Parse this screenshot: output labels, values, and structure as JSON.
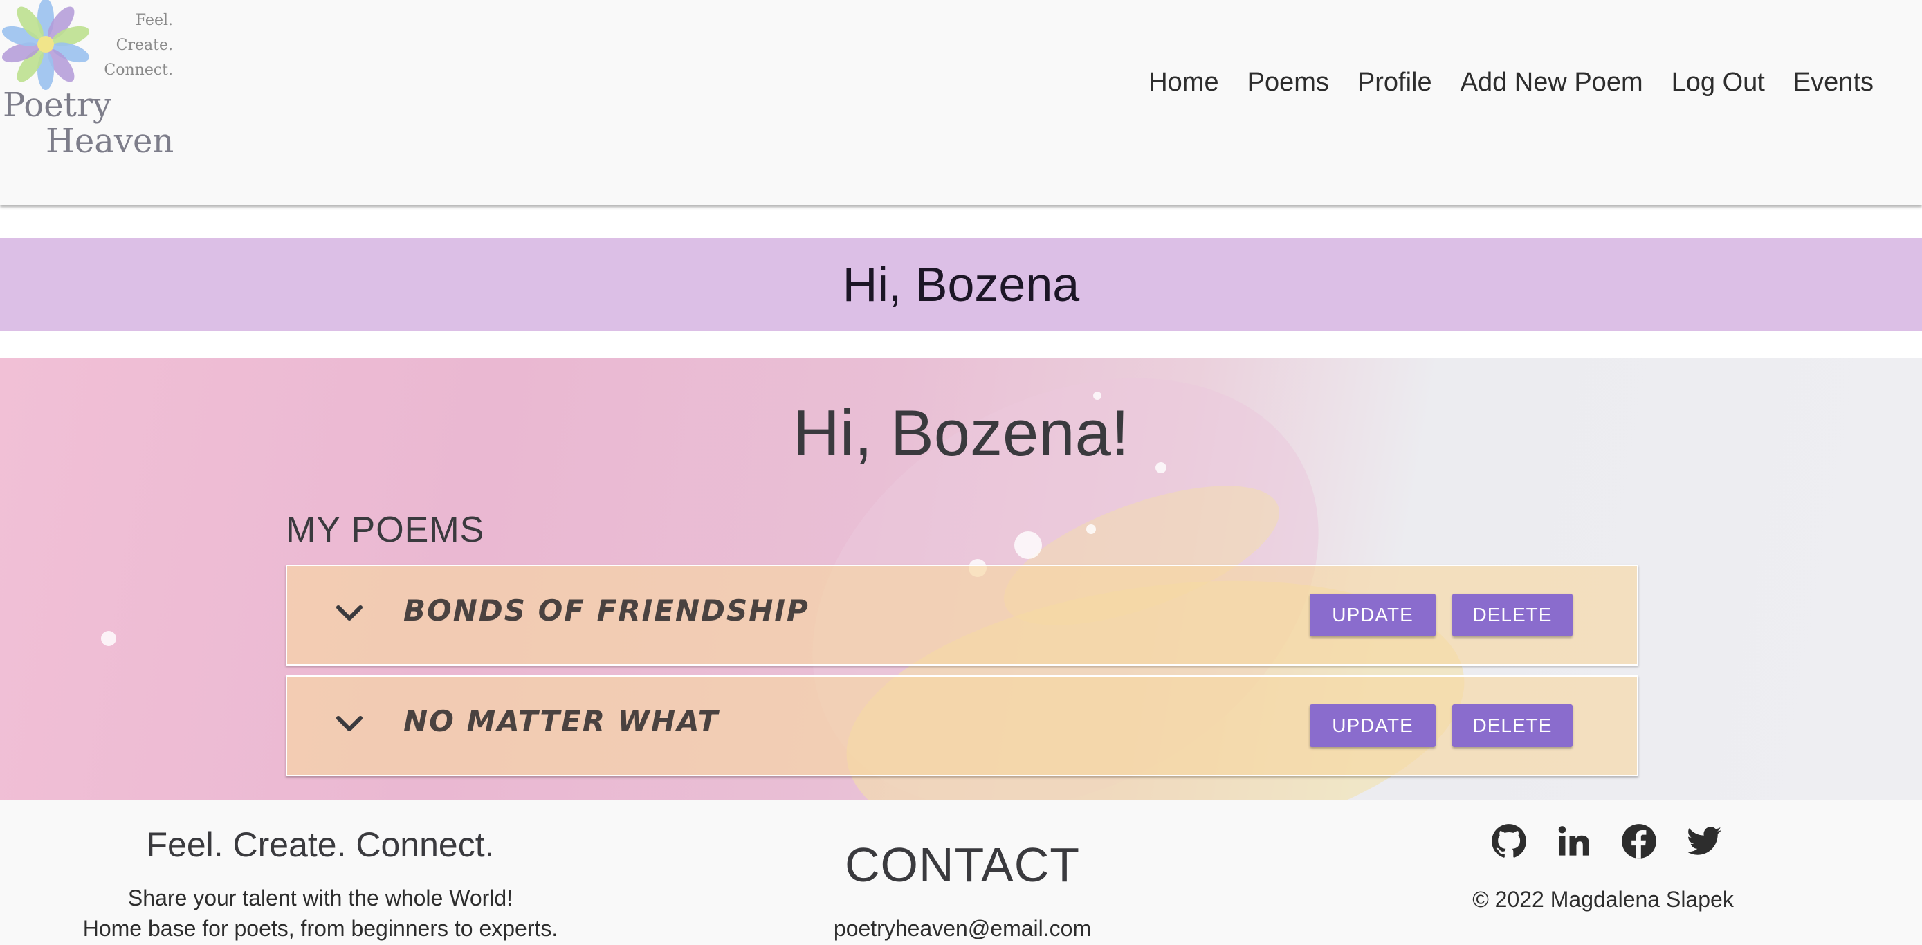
{
  "logo": {
    "tagline": [
      "Feel.",
      "Create.",
      "Connect."
    ],
    "title_line1": "Poetry",
    "title_line2": "Heaven"
  },
  "nav": {
    "items": [
      "Home",
      "Poems",
      "Profile",
      "Add New Poem",
      "Log Out",
      "Events"
    ]
  },
  "greeting_band": {
    "text": "Hi, Bozena"
  },
  "hero": {
    "heading": "Hi, Bozena!",
    "section_title": "MY POEMS",
    "poems": [
      {
        "title": "BONDS OF FRIENDSHIP",
        "update_label": "UPDATE",
        "delete_label": "DELETE"
      },
      {
        "title": "NO MATTER WHAT",
        "update_label": "UPDATE",
        "delete_label": "DELETE"
      }
    ]
  },
  "footer": {
    "tagline": "Feel. Create. Connect.",
    "description_line1": "Share your talent with the whole World!",
    "description_line2": "Home base for poets, from beginners to experts.",
    "contact_title": "CONTACT",
    "contact_email": "poetryheaven@email.com",
    "social_icons": [
      "github-icon",
      "linkedin-icon",
      "facebook-icon",
      "twitter-icon"
    ],
    "copyright": "© 2022 Magdalena Slapek"
  },
  "colors": {
    "accent_button": "#8a6ccd",
    "greeting_band": "#dcbfe6",
    "poem_row": "#f7d7a0"
  }
}
